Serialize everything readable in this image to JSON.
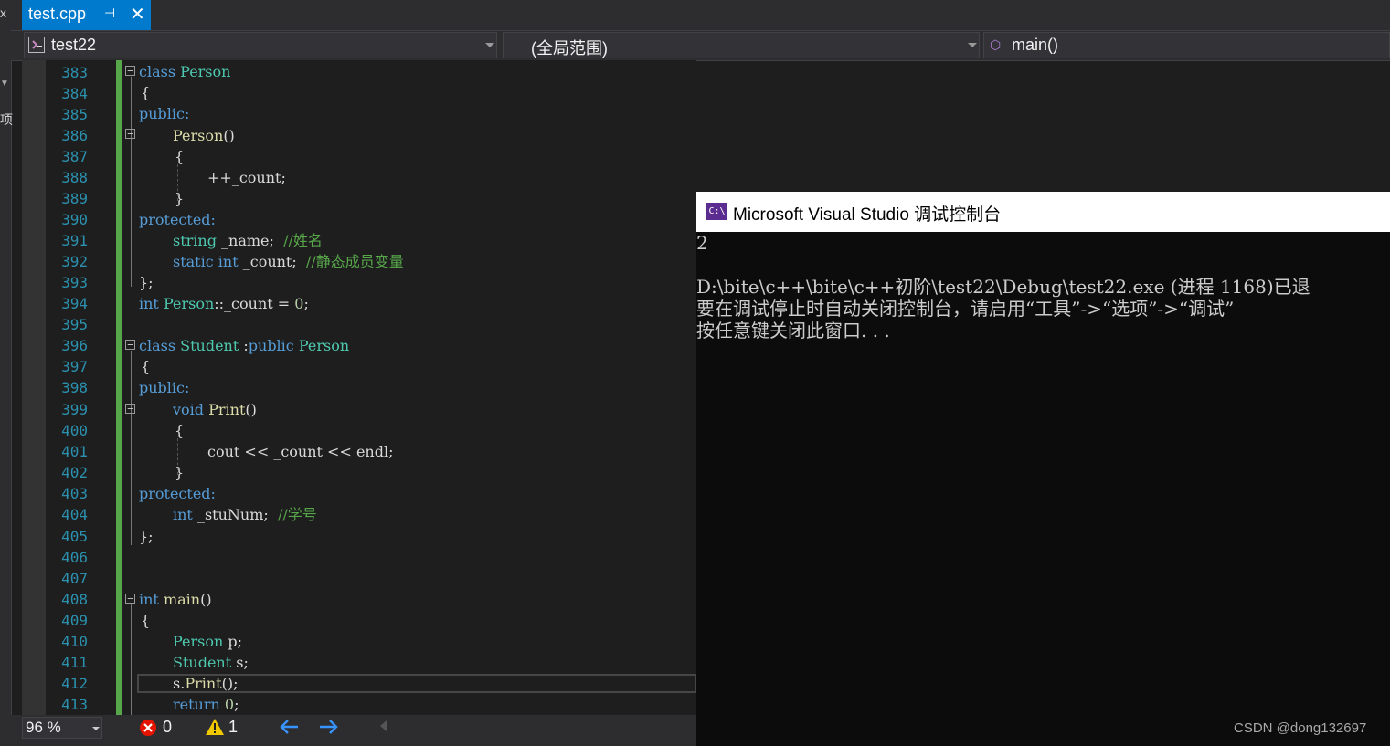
{
  "tab": {
    "filename": "test.cpp",
    "pin": "⊣",
    "close": "✕"
  },
  "nav": {
    "project": "test22",
    "scope": "(全局范围)",
    "function": "main()"
  },
  "editor": {
    "lines": [
      {
        "n": "383"
      },
      {
        "n": "384"
      },
      {
        "n": "385"
      },
      {
        "n": "386"
      },
      {
        "n": "387"
      },
      {
        "n": "388"
      },
      {
        "n": "389"
      },
      {
        "n": "390"
      },
      {
        "n": "391"
      },
      {
        "n": "392"
      },
      {
        "n": "393"
      },
      {
        "n": "394"
      },
      {
        "n": "395"
      },
      {
        "n": "396"
      },
      {
        "n": "397"
      },
      {
        "n": "398"
      },
      {
        "n": "399"
      },
      {
        "n": "400"
      },
      {
        "n": "401"
      },
      {
        "n": "402"
      },
      {
        "n": "403"
      },
      {
        "n": "404"
      },
      {
        "n": "405"
      },
      {
        "n": "406"
      },
      {
        "n": "407"
      },
      {
        "n": "408"
      },
      {
        "n": "409"
      },
      {
        "n": "410"
      },
      {
        "n": "411"
      },
      {
        "n": "412"
      },
      {
        "n": "413"
      }
    ],
    "code": {
      "l383_kw": "class",
      "l383_ty": "Person",
      "l384": "{",
      "l385": "public:",
      "l386_fn": "Person",
      "l386_p": "()",
      "l387": "{",
      "l388_a": "++",
      "l388_b": "_count",
      "l388_c": ";",
      "l389": "}",
      "l390": "protected:",
      "l391_ty": "string",
      "l391_id": " _name;",
      "l391_cm": "//姓名",
      "l392_kw1": "static",
      "l392_kw2": "int",
      "l392_id": " _count;",
      "l392_cm": "//静态成员变量",
      "l393": "};",
      "l394_kw": "int",
      "l394_ty": "Person",
      "l394_rest": "::_count = ",
      "l394_nm": "0",
      "l394_end": ";",
      "l396_kw": "class",
      "l396_ty": "Student",
      "l396_colon": " :",
      "l396_kw2": "public",
      "l396_ty2": "Person",
      "l397": "{",
      "l398": "public:",
      "l399_kw": "void",
      "l399_fn": "Print",
      "l399_p": "()",
      "l400": "{",
      "l401_a": "cout",
      "l401_b": " << ",
      "l401_c": "_count",
      "l401_d": " << ",
      "l401_e": "endl",
      "l401_f": ";",
      "l402": "}",
      "l403": "protected:",
      "l404_kw": "int",
      "l404_id": " _stuNum;",
      "l404_cm": "//学号",
      "l405": "};",
      "l408_kw": "int",
      "l408_fn": "main",
      "l408_p": "()",
      "l409": "{",
      "l410_ty": "Person",
      "l410_id": " p;",
      "l411_ty": "Student",
      "l411_id": " s;",
      "l412_a": "s",
      "l412_b": ".",
      "l412_fn": "Print",
      "l412_c": "();",
      "l413_kw": "return",
      "l413_nm": " 0",
      "l413_c": ";"
    }
  },
  "status": {
    "zoom": "96 %",
    "errors": "0",
    "warnings": "1"
  },
  "console": {
    "title": "Microsoft Visual Studio 调试控制台",
    "icon_label": "C:\\",
    "lines": [
      "2",
      "",
      "D:\\bite\\c++\\bite\\c++初阶\\test22\\Debug\\test22.exe (进程 1168)已退",
      "要在调试停止时自动关闭控制台，请启用“工具”->“选项”->“调试”",
      "按任意键关闭此窗口. . ."
    ]
  },
  "watermark": "CSDN @dong132697",
  "left_strip": {
    "top_char": "x",
    "mid_char": "项"
  }
}
